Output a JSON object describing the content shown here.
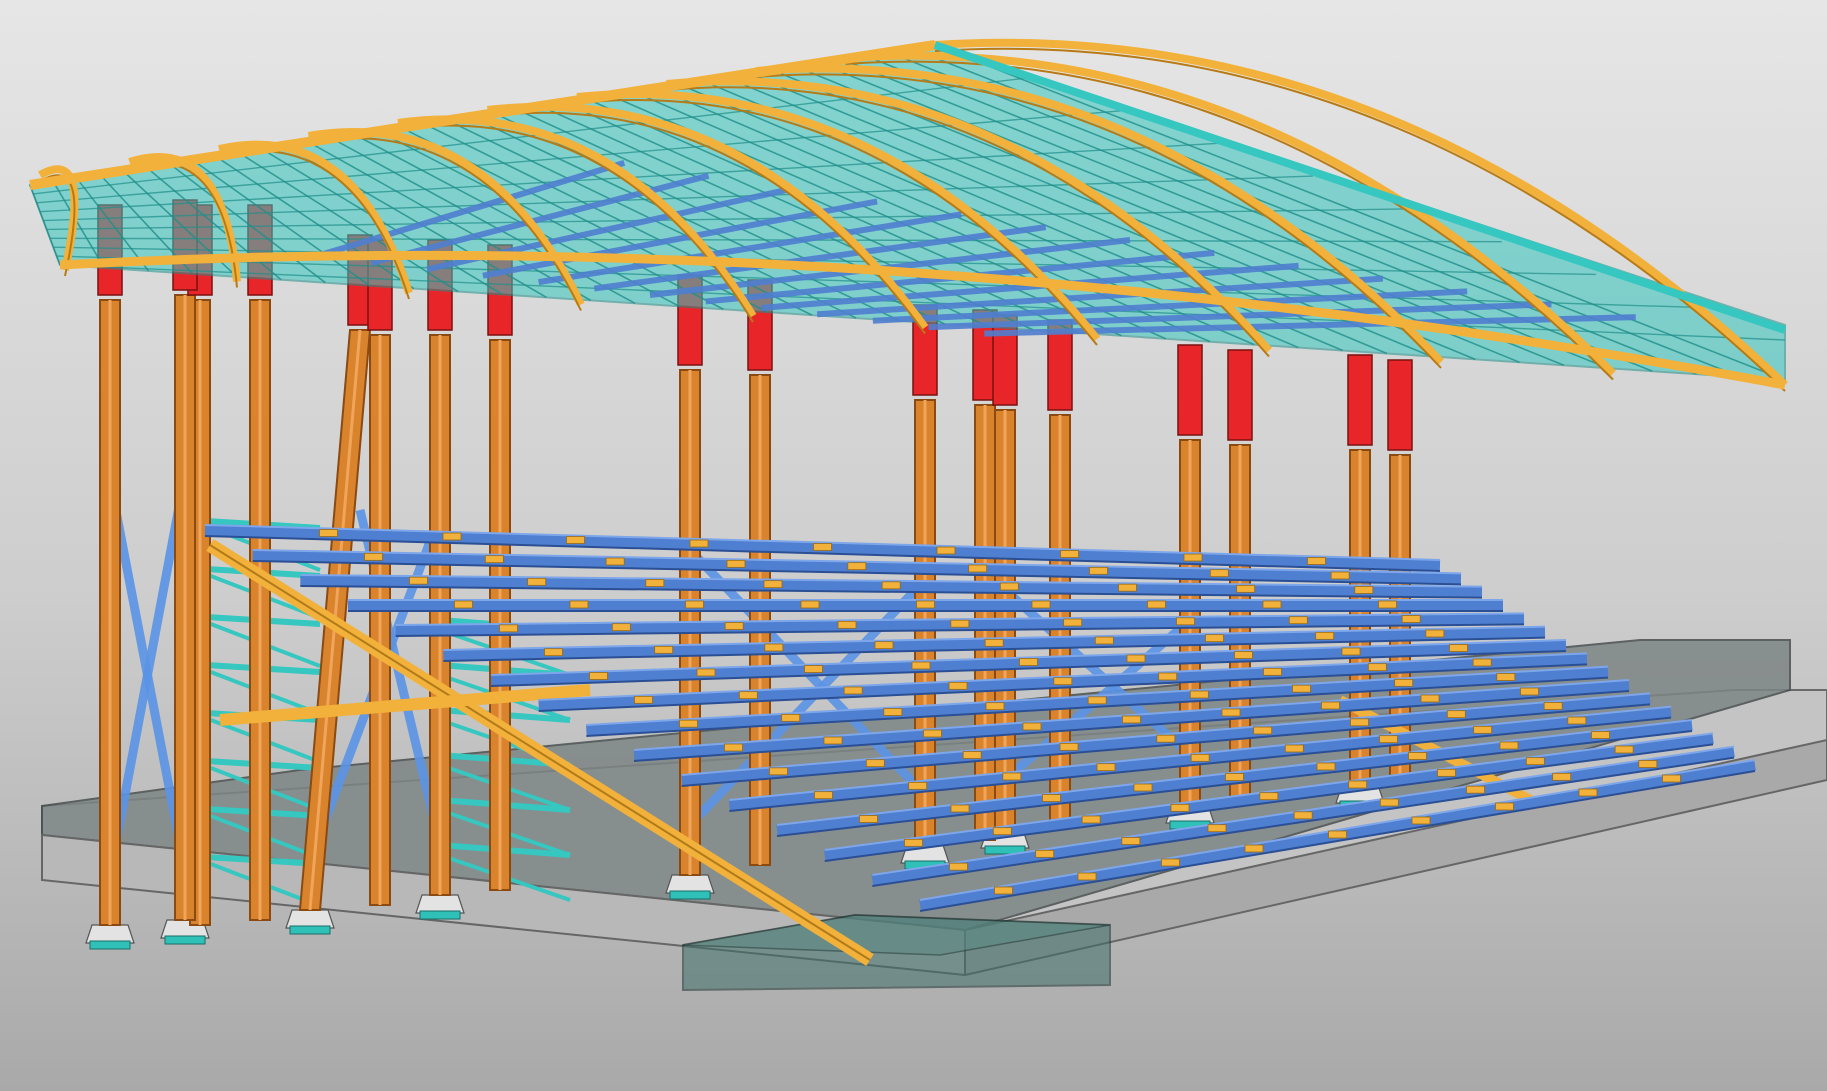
{
  "scene": {
    "subject": "steel-stadium-grandstand-3d-model",
    "colors": {
      "background_top": "#e6e6e6",
      "background_bottom": "#a9a9a9",
      "column": "#d9832c",
      "column_edge": "#8a4a12",
      "top_chord": "#f2b13a",
      "truss": "#35c7c0",
      "truss_dark": "#1f8f8a",
      "purlin": "#4f7fd0",
      "purlin_dark": "#2b4f94",
      "bracing": "#5b94e6",
      "highlight": "#e8262a",
      "slab_top": "#7d8585",
      "slab_side": "#c4c4c4",
      "pit_glass": "#3f6f6a"
    },
    "counts": {
      "column_lines": 9,
      "seating_rows": 16,
      "roof_ribs": 11
    }
  }
}
